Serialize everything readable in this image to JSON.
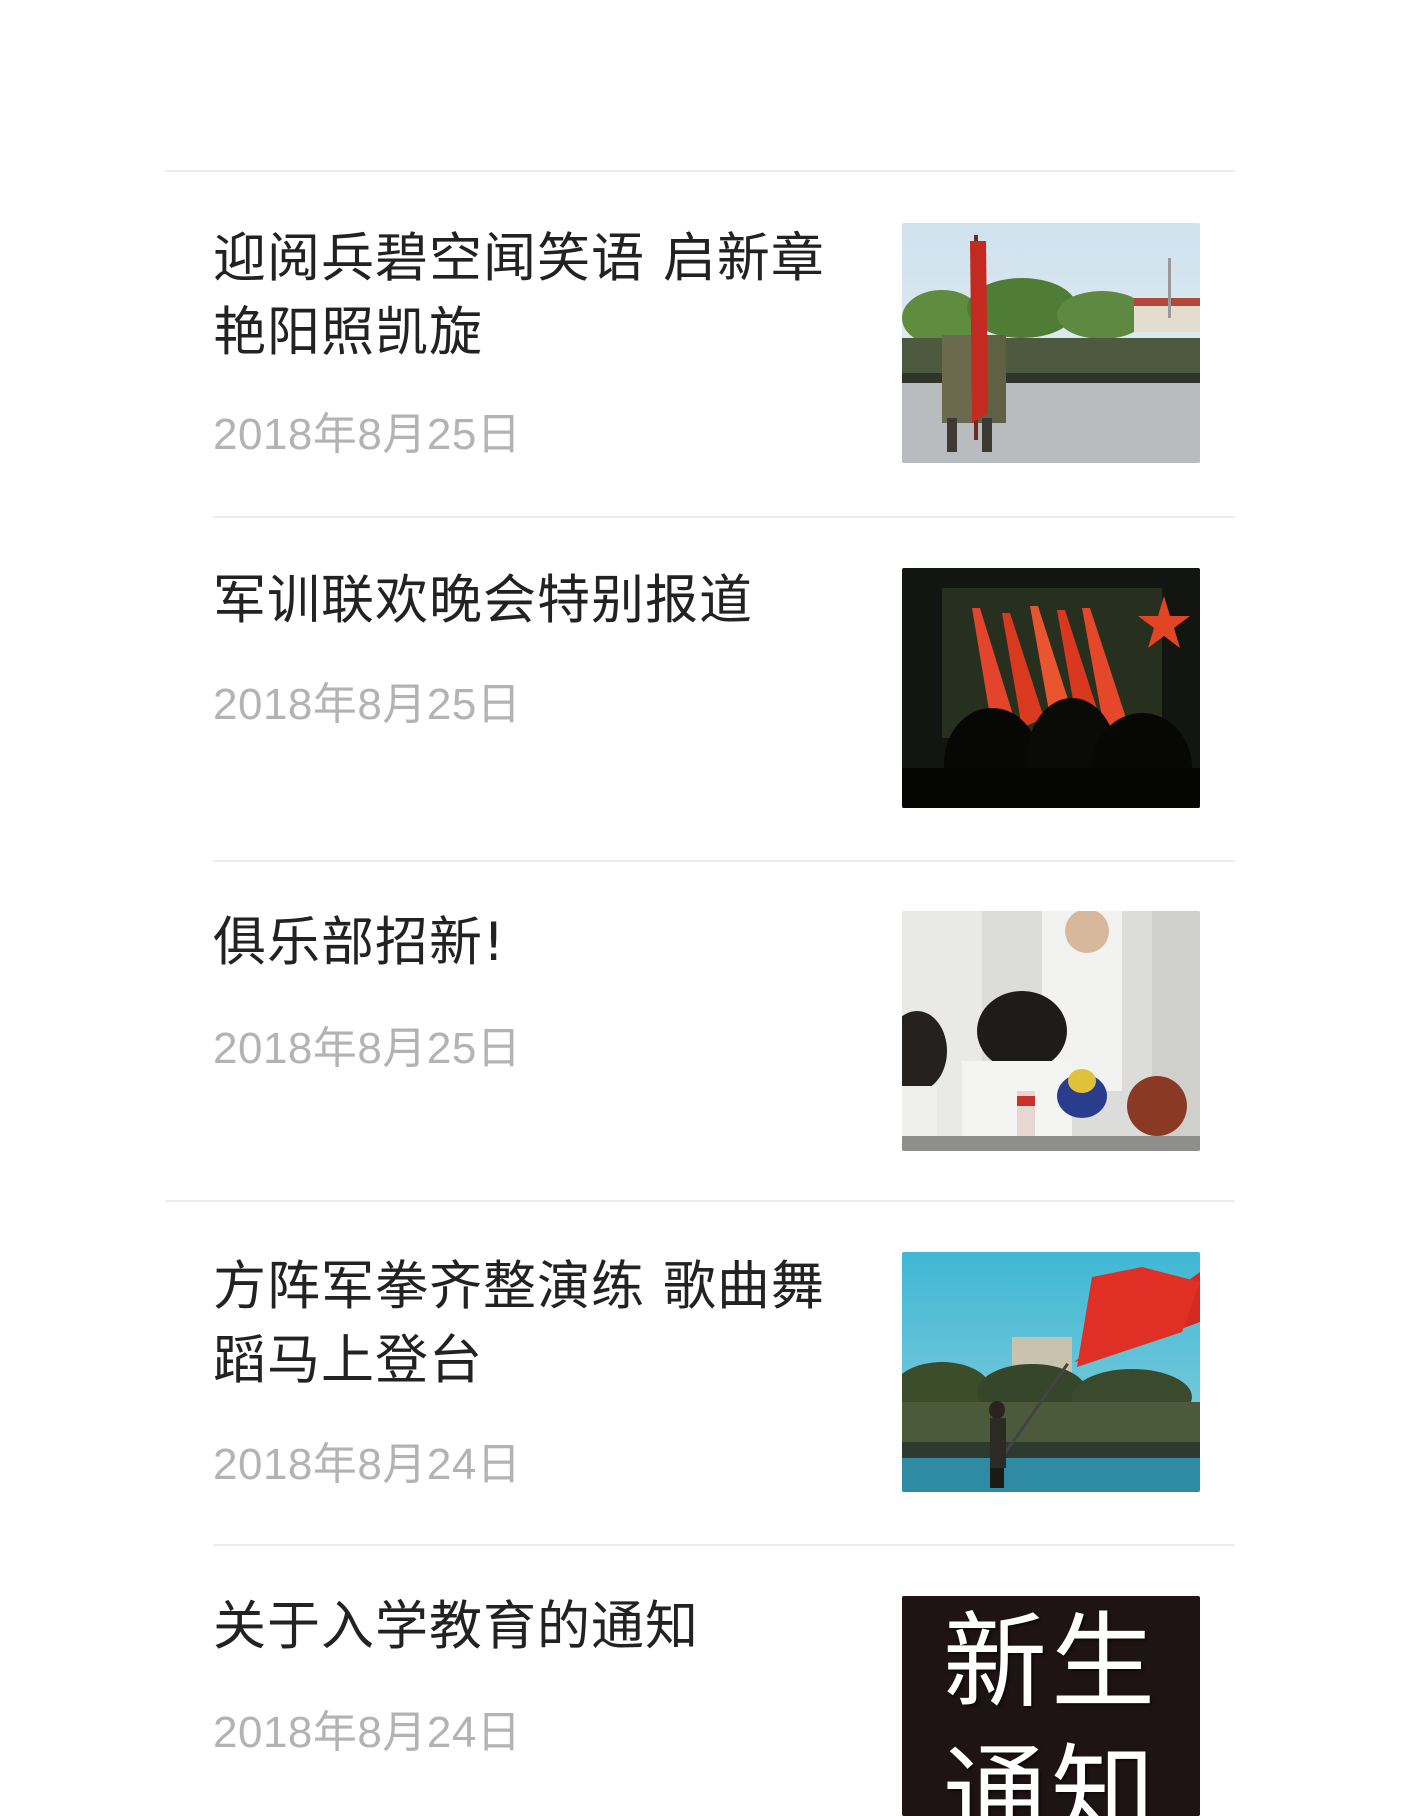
{
  "articles": [
    {
      "title": "迎阅兵碧空闻笑语 启新章艳阳照凯旋",
      "date": "2018年8月25日",
      "thumbnail_icon": "military-parade-photo"
    },
    {
      "title": "军训联欢晚会特别报道",
      "date": "2018年8月25日",
      "thumbnail_icon": "red-flags-stage-photo"
    },
    {
      "title": "俱乐部招新!",
      "date": "2018年8月25日",
      "thumbnail_icon": "club-recruitment-photo"
    },
    {
      "title": "方阵军拳齐整演练 歌曲舞蹈马上登台",
      "date": "2018年8月24日",
      "thumbnail_icon": "flag-waving-photo"
    },
    {
      "title": "关于入学教育的通知",
      "date": "2018年8月24日",
      "thumbnail_icon": "notice-card-image",
      "thumbnail_text": "新生通知"
    }
  ],
  "colors": {
    "title": "#222222",
    "date": "#b3b3b3",
    "divider": "#ececec",
    "background": "#ffffff"
  }
}
